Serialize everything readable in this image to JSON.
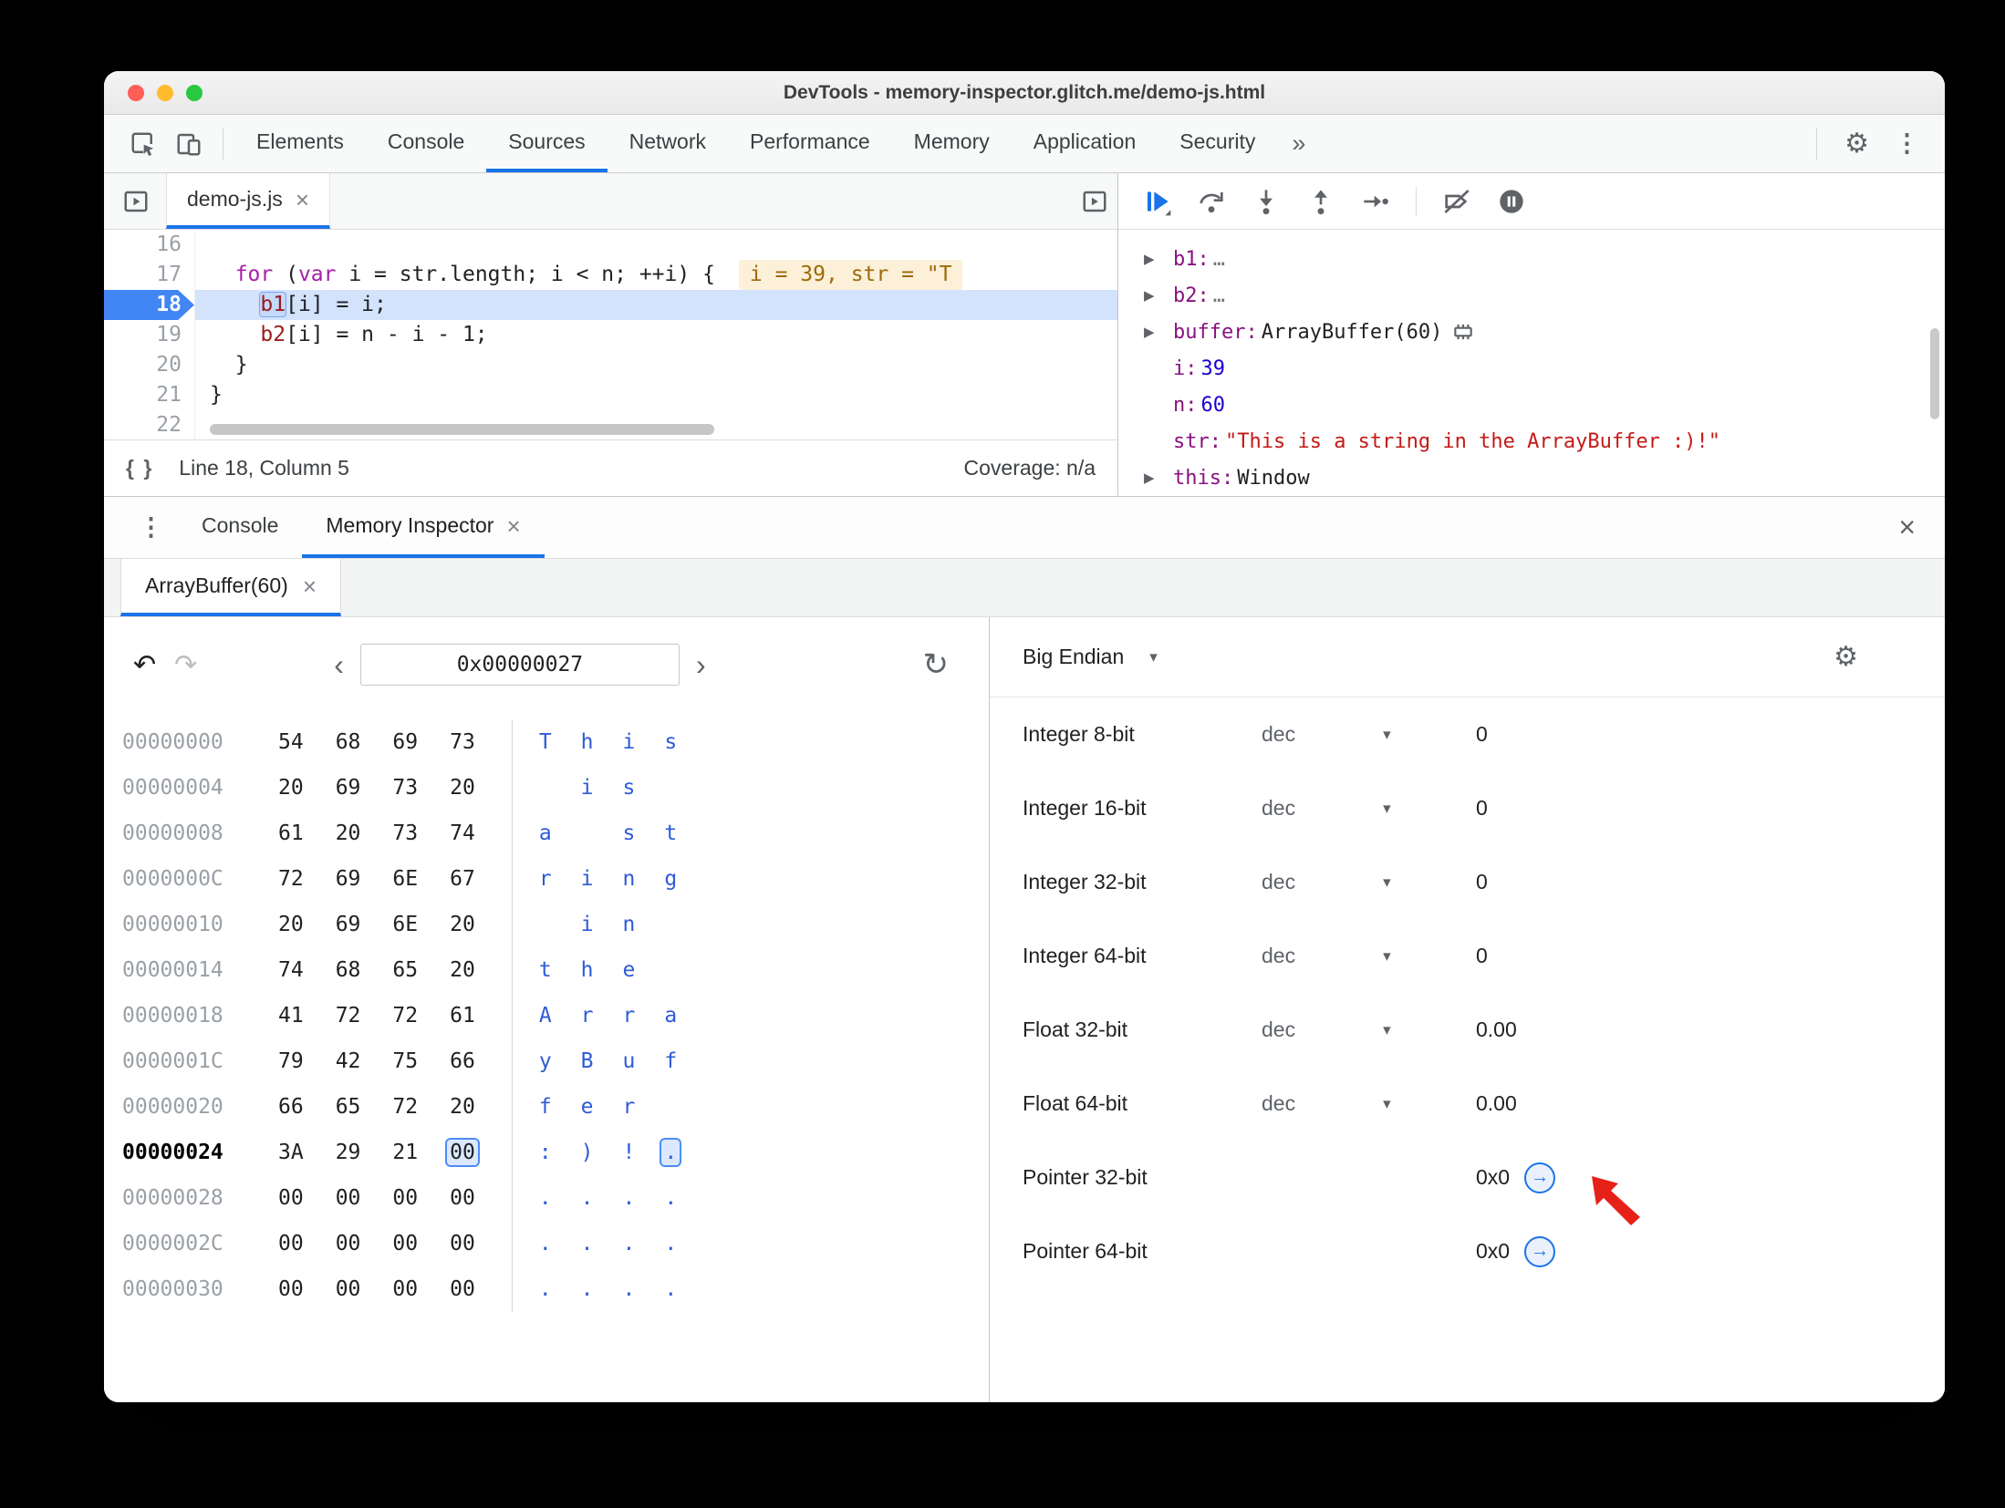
{
  "window": {
    "title": "DevTools - memory-inspector.glitch.me/demo-js.html"
  },
  "toolbar": {
    "tabs": [
      {
        "label": "Elements",
        "active": false
      },
      {
        "label": "Console",
        "active": false
      },
      {
        "label": "Sources",
        "active": true
      },
      {
        "label": "Network",
        "active": false
      },
      {
        "label": "Performance",
        "active": false
      },
      {
        "label": "Memory",
        "active": false
      },
      {
        "label": "Application",
        "active": false
      },
      {
        "label": "Security",
        "active": false
      }
    ]
  },
  "icons": {
    "more_tabs": "»",
    "gear": "⚙",
    "kebab": "⋮",
    "close": "×",
    "format": "{ }",
    "undo": "↶",
    "redo": "↷",
    "chevron_left": "‹",
    "chevron_right": "›",
    "refresh": "↻",
    "caret": "▾",
    "disclosure": "▶",
    "jump_arrow": "→"
  },
  "sources": {
    "file_tab": {
      "label": "demo-js.js"
    },
    "code_lines": [
      {
        "no": "16",
        "tokens": []
      },
      {
        "no": "17",
        "tokens": [
          {
            "t": "  "
          },
          {
            "t": "for",
            "c": "kw"
          },
          {
            "t": " ("
          },
          {
            "t": "var",
            "c": "kw"
          },
          {
            "t": " i = str.length; i < n; ++i) {"
          }
        ],
        "annotation": "i = 39, str = \"T"
      },
      {
        "no": "18",
        "current": true,
        "tokens": [
          {
            "t": "    "
          },
          {
            "t": "b1",
            "c": "var",
            "boxed": true
          },
          {
            "t": "[i] = i;"
          }
        ]
      },
      {
        "no": "19",
        "tokens": [
          {
            "t": "    "
          },
          {
            "t": "b2",
            "c": "var"
          },
          {
            "t": "[i] = n - i - 1;"
          }
        ]
      },
      {
        "no": "20",
        "tokens": [
          {
            "t": "  }"
          }
        ]
      },
      {
        "no": "21",
        "tokens": [
          {
            "t": "}"
          }
        ]
      },
      {
        "no": "22",
        "tokens": []
      }
    ],
    "status": {
      "line_col": "Line 18, Column 5",
      "coverage": "Coverage: n/a"
    }
  },
  "debugger": {
    "scope_items": [
      {
        "arrow": true,
        "name": "b1",
        "value": "…",
        "vclass": "muted"
      },
      {
        "arrow": true,
        "name": "b2",
        "value": "…",
        "vclass": "muted"
      },
      {
        "arrow": true,
        "name": "buffer",
        "value": "ArrayBuffer(60)",
        "vclass": "plain",
        "icon": "memory-chip"
      },
      {
        "arrow": false,
        "name": "i",
        "value": "39",
        "vclass": "num"
      },
      {
        "arrow": false,
        "name": "n",
        "value": "60",
        "vclass": "num"
      },
      {
        "arrow": false,
        "name": "str",
        "value": "\"This is a string in the ArrayBuffer :)!\"",
        "vclass": "str"
      },
      {
        "arrow": true,
        "name": "this",
        "value": "Window",
        "vclass": "plain"
      }
    ]
  },
  "drawer": {
    "tabs": [
      {
        "label": "Console"
      },
      {
        "label": "Memory Inspector"
      }
    ],
    "buffer_tab": {
      "label": "ArrayBuffer(60)"
    }
  },
  "memory": {
    "address_value": "0x00000027",
    "rows": [
      {
        "addr": "00000000",
        "bytes": [
          "54",
          "68",
          "69",
          "73"
        ],
        "ascii": [
          "T",
          "h",
          "i",
          "s"
        ]
      },
      {
        "addr": "00000004",
        "bytes": [
          "20",
          "69",
          "73",
          "20"
        ],
        "ascii": [
          " ",
          "i",
          "s",
          " "
        ]
      },
      {
        "addr": "00000008",
        "bytes": [
          "61",
          "20",
          "73",
          "74"
        ],
        "ascii": [
          "a",
          " ",
          "s",
          "t"
        ]
      },
      {
        "addr": "0000000C",
        "bytes": [
          "72",
          "69",
          "6E",
          "67"
        ],
        "ascii": [
          "r",
          "i",
          "n",
          "g"
        ]
      },
      {
        "addr": "00000010",
        "bytes": [
          "20",
          "69",
          "6E",
          "20"
        ],
        "ascii": [
          " ",
          "i",
          "n",
          " "
        ]
      },
      {
        "addr": "00000014",
        "bytes": [
          "74",
          "68",
          "65",
          "20"
        ],
        "ascii": [
          "t",
          "h",
          "e",
          " "
        ]
      },
      {
        "addr": "00000018",
        "bytes": [
          "41",
          "72",
          "72",
          "61"
        ],
        "ascii": [
          "A",
          "r",
          "r",
          "a"
        ]
      },
      {
        "addr": "0000001C",
        "bytes": [
          "79",
          "42",
          "75",
          "66"
        ],
        "ascii": [
          "y",
          "B",
          "u",
          "f"
        ]
      },
      {
        "addr": "00000020",
        "bytes": [
          "66",
          "65",
          "72",
          "20"
        ],
        "ascii": [
          "f",
          "e",
          "r",
          " "
        ]
      },
      {
        "addr": "00000024",
        "current": true,
        "sel": 3,
        "bytes": [
          "3A",
          "29",
          "21",
          "00"
        ],
        "ascii": [
          ":",
          ")",
          "!",
          "."
        ]
      },
      {
        "addr": "00000028",
        "bytes": [
          "00",
          "00",
          "00",
          "00"
        ],
        "ascii": [
          ".",
          ".",
          ".",
          "."
        ]
      },
      {
        "addr": "0000002C",
        "bytes": [
          "00",
          "00",
          "00",
          "00"
        ],
        "ascii": [
          ".",
          ".",
          ".",
          "."
        ]
      },
      {
        "addr": "00000030",
        "bytes": [
          "00",
          "00",
          "00",
          "00"
        ],
        "ascii": [
          ".",
          ".",
          ".",
          "."
        ]
      }
    ]
  },
  "interpreter": {
    "endianness": "Big Endian",
    "rows": [
      {
        "label": "Integer 8-bit",
        "mode": "dec",
        "value": "0"
      },
      {
        "label": "Integer 16-bit",
        "mode": "dec",
        "value": "0"
      },
      {
        "label": "Integer 32-bit",
        "mode": "dec",
        "value": "0"
      },
      {
        "label": "Integer 64-bit",
        "mode": "dec",
        "value": "0"
      },
      {
        "label": "Float 32-bit",
        "mode": "dec",
        "value": "0.00"
      },
      {
        "label": "Float 64-bit",
        "mode": "dec",
        "value": "0.00"
      },
      {
        "label": "Pointer 32-bit",
        "mode": null,
        "value": "0x0",
        "jump": true,
        "annotated": true
      },
      {
        "label": "Pointer 64-bit",
        "mode": null,
        "value": "0x0",
        "jump": true
      }
    ]
  }
}
